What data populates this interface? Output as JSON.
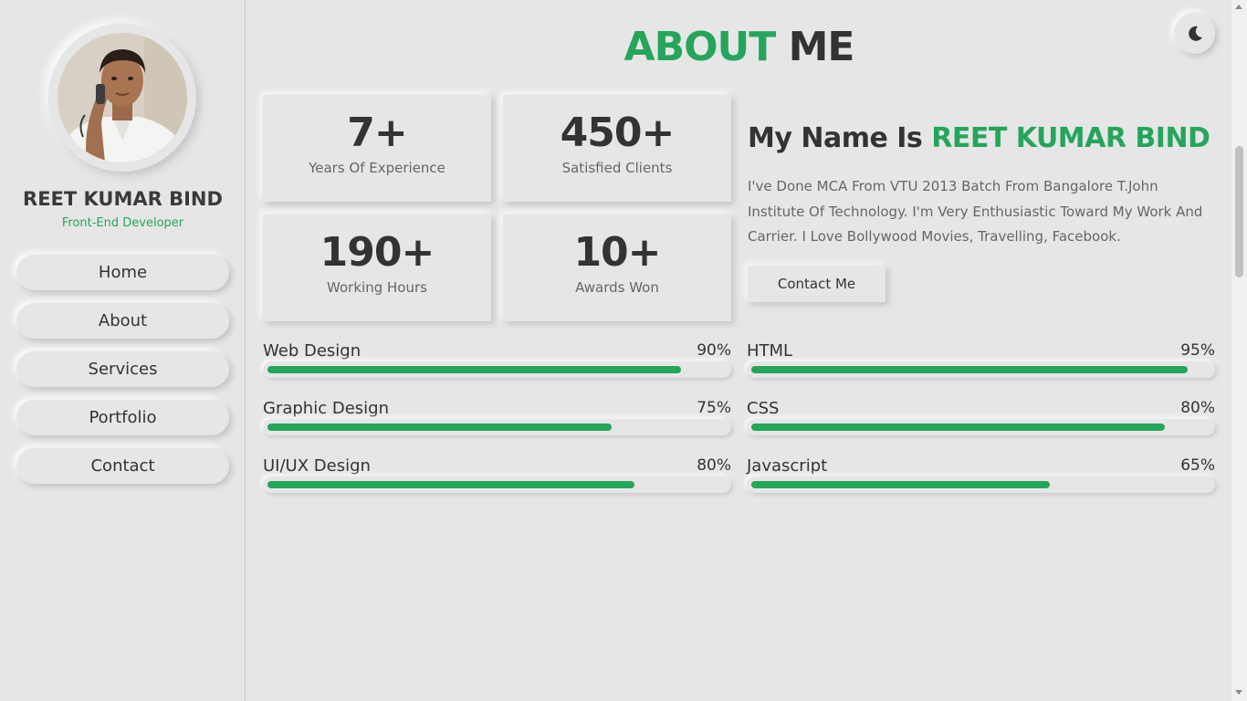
{
  "profile": {
    "name": "REET KUMAR BIND",
    "role": "Front-End Developer"
  },
  "nav": {
    "items": [
      {
        "label": "Home"
      },
      {
        "label": "About"
      },
      {
        "label": "Services"
      },
      {
        "label": "Portfolio"
      },
      {
        "label": "Contact"
      }
    ]
  },
  "theme_toggle": {
    "icon": "moon-icon"
  },
  "heading": {
    "part1": "ABOUT",
    "part2": "ME"
  },
  "stats": [
    {
      "value": "7+",
      "label": "Years Of Experience"
    },
    {
      "value": "450+",
      "label": "Satisfied Clients"
    },
    {
      "value": "190+",
      "label": "Working Hours"
    },
    {
      "value": "10+",
      "label": "Awards Won"
    }
  ],
  "intro": {
    "title_prefix": "My Name Is",
    "title_name": "REET KUMAR BIND",
    "text": "I've Done MCA From VTU 2013 Batch From Bangalore T.John Institute Of Technology. I'm Very Enthusiastic Toward My Work And Carrier. I Love Bollywood Movies, Travelling, Facebook.",
    "button_label": "Contact Me"
  },
  "skills": {
    "left": [
      {
        "name": "Web Design",
        "percent_label": "90%",
        "level": 0.9
      },
      {
        "name": "Graphic Design",
        "percent_label": "75%",
        "level": 0.75
      },
      {
        "name": "UI/UX Design",
        "percent_label": "80%",
        "level": 0.8
      }
    ],
    "right": [
      {
        "name": "HTML",
        "percent_label": "95%",
        "level": 0.95
      },
      {
        "name": "CSS",
        "percent_label": "80%",
        "level": 0.9
      },
      {
        "name": "Javascript",
        "percent_label": "65%",
        "level": 0.65
      }
    ]
  },
  "colors": {
    "accent": "#25a55c",
    "background": "#e6e6e6",
    "text_dark": "#333333",
    "text_muted": "#666666"
  }
}
